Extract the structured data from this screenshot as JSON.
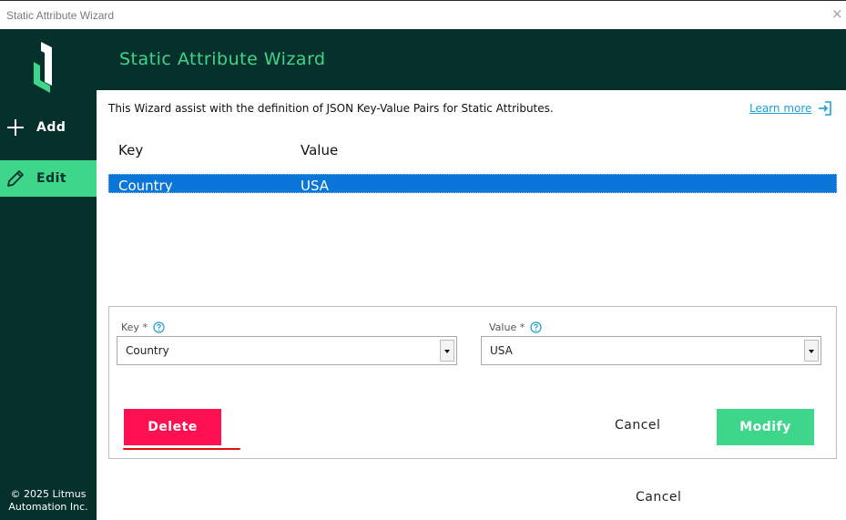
{
  "window": {
    "title": "Static Attribute Wizard",
    "close_glyph": "×"
  },
  "sidebar": {
    "logo_icon": "litmus-logo-icon",
    "items": [
      {
        "label": "Add",
        "icon": "plus-icon",
        "active": false
      },
      {
        "label": "Edit",
        "icon": "pencil-icon",
        "active": true
      }
    ],
    "copyright_line1": "© 2025 Litmus",
    "copyright_line2": "Automation Inc."
  },
  "header": {
    "title": "Static Attribute Wizard"
  },
  "main": {
    "intro": "This Wizard assist with the definition of JSON Key-Value Pairs for Static Attributes.",
    "learn_more": "Learn more",
    "table": {
      "columns": [
        "Key",
        "Value"
      ],
      "rows": [
        {
          "key": "Country",
          "value": "USA",
          "selected": true
        }
      ]
    },
    "editor": {
      "key_label": "Key *",
      "key_value": "Country",
      "value_label": "Value *",
      "value_value": "USA",
      "delete_label": "Delete",
      "cancel_label": "Cancel",
      "modify_label": "Modify"
    },
    "cancel_label": "Cancel"
  },
  "colors": {
    "sidebar_bg": "#05302b",
    "accent_green": "#3ed68b",
    "selection_blue": "#0a76d8",
    "delete_red": "#ff1050",
    "link_blue": "#1a9fd1"
  }
}
